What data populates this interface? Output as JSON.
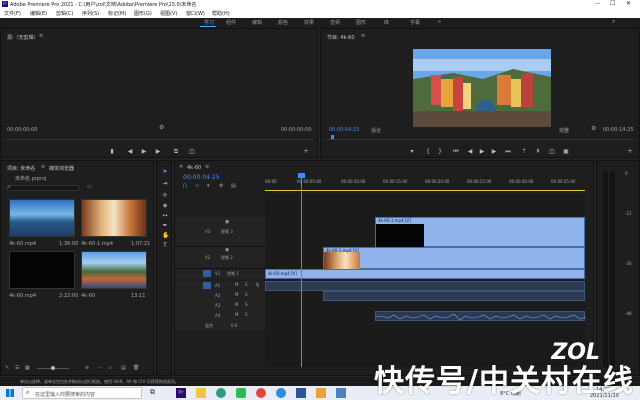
{
  "window": {
    "title": "Adobe Premiere Pro 2021 - C:\\用户\\zol\\文档\\Adobe\\Premiere Pro\\15.0\\未命名",
    "controls": [
      "minimize-icon",
      "maximize-icon",
      "close-icon"
    ]
  },
  "menu": [
    "文件(F)",
    "编辑(E)",
    "剪辑(C)",
    "序列(S)",
    "标记(M)",
    "图形(G)",
    "视图(V)",
    "窗口(W)",
    "帮助(H)"
  ],
  "workspaces": [
    "学习",
    "组件",
    "编辑",
    "颜色",
    "效果",
    "音频",
    "图形",
    "库",
    "字幕"
  ],
  "workspaces_active": "学习",
  "source_monitor": {
    "title": "源:（无剪辑）",
    "timecode_left": "00:00:00:00",
    "timecode_right": "00:00:00:00"
  },
  "program_monitor": {
    "title": "节目: 4k-60",
    "timecode_left": "00:00:04:25",
    "fit": "适合",
    "quality": "完整",
    "timecode_right": "00:00:14:25"
  },
  "project_panel": {
    "title": "项目: 未命名",
    "tab2": "媒体浏览器",
    "file": "未命名.prproj",
    "items": [
      {
        "name": "4k-60.mp4",
        "duration": "1:36:00"
      },
      {
        "name": "4k-60-1.mp4",
        "duration": "1:07:21"
      },
      {
        "name": "4k-60.mp4",
        "duration": "2:22:00"
      },
      {
        "name": "4k-60",
        "duration": "13:11"
      }
    ]
  },
  "timeline": {
    "title": "4k-60",
    "timecode": "00:00:04:25",
    "ruler": [
      "00:00",
      "00:00:05:00",
      "00:00:10:00",
      "00:00:15:00",
      "00:00:20:00",
      "00:00:25:00",
      "00:00:30:00",
      "00:00:35:00"
    ],
    "video_tracks": [
      {
        "id": "V3",
        "name": "视频 3"
      },
      {
        "id": "V2",
        "name": "视频 2"
      },
      {
        "id": "V1",
        "name": "视频 1"
      }
    ],
    "audio_tracks": [
      "A1",
      "A2",
      "A3",
      "A4"
    ],
    "mix_label": "混合",
    "mix_value": "0.0",
    "clip_v3": "4k-60-1.mp4 [V]",
    "clip_v2": "4k-60-1.mp4 [V]",
    "clip_v1": "4k-60.mp4 [V]"
  },
  "status": {
    "text": "单击以选择，或单击空白处并拖动以进行框选。使用 Shift、Alt 和 Ctrl 可获得其他选项。"
  },
  "taskbar": {
    "search_placeholder": "在这里输入你要搜索的内容",
    "weather": "8°C 晴朗",
    "time": "14:22",
    "date": "2021/11/10"
  },
  "overlay": {
    "watermark": "快传号/中关村在线",
    "logo": "ZOL"
  }
}
